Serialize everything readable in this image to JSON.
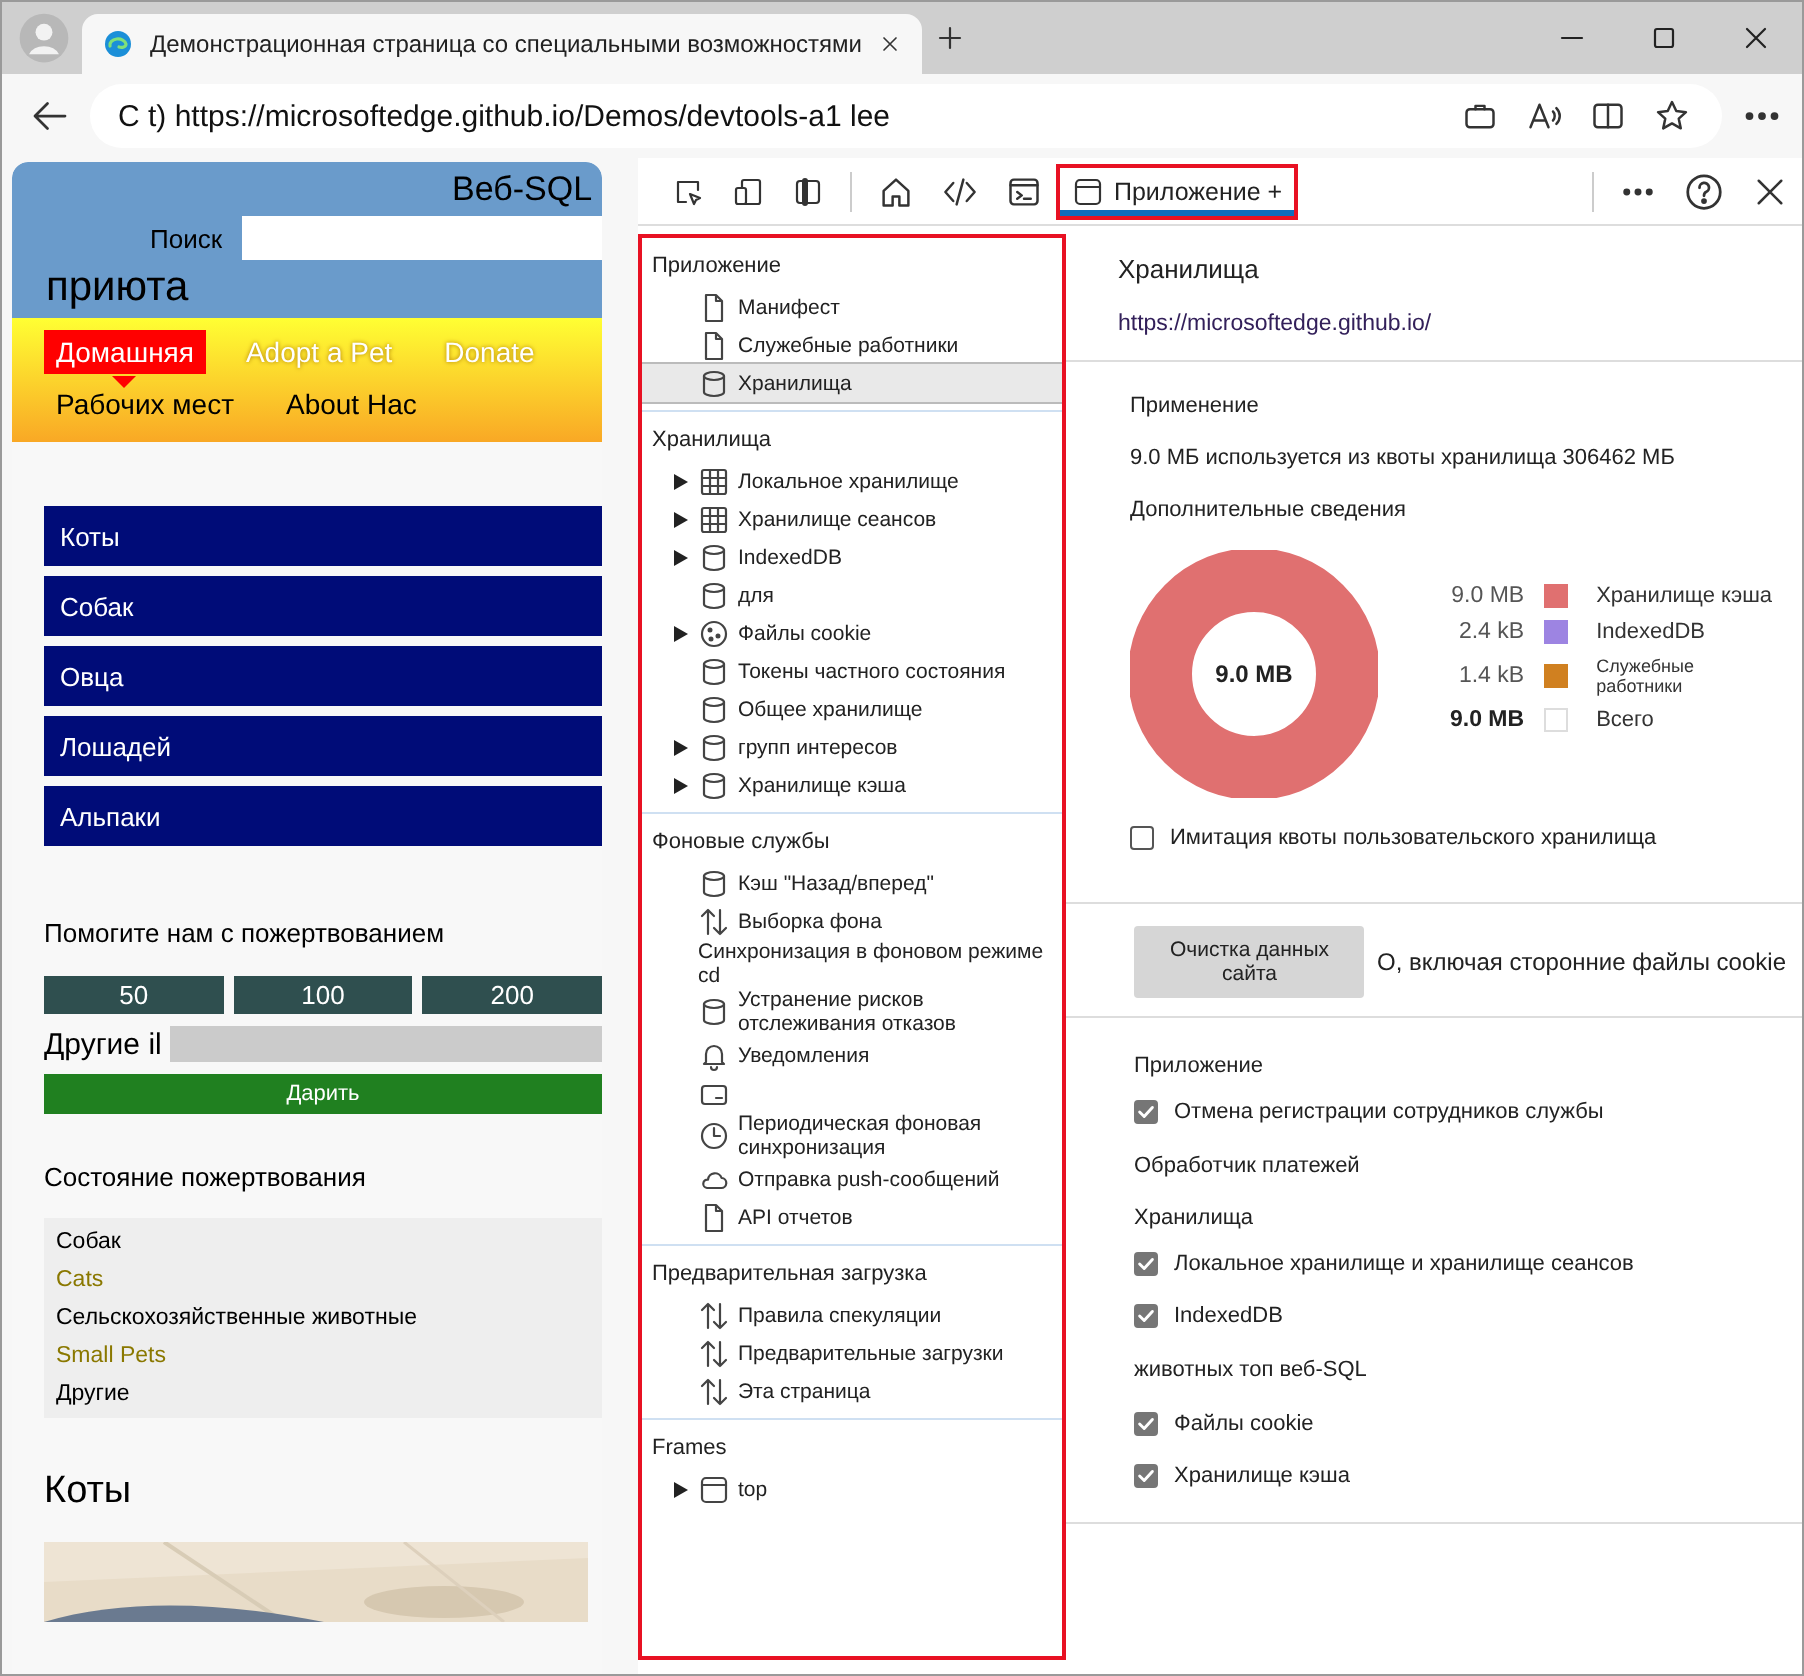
{
  "browser": {
    "tab_title": "Демонстрационная страница со специальными возможностями",
    "url": "C t) https://microsoftedge.github.io/Demos/devtools-a1 lee"
  },
  "page": {
    "header": {
      "overlay_title": "Веб-SQL",
      "search_label": "Поиск",
      "title": "приюта"
    },
    "nav": [
      {
        "label": "Домашняя",
        "selected": true
      },
      {
        "label": "Adopt a Pet",
        "selected": false
      },
      {
        "label": "Donate",
        "selected": false
      },
      {
        "label": "Рабочих мест",
        "selected": false
      },
      {
        "label": "About Нас",
        "selected": false
      }
    ],
    "categories": [
      "Коты",
      "Собак",
      "Овца",
      "Лошадей",
      "Альпаки"
    ],
    "donate": {
      "heading": "Помогите нам с пожертвованием",
      "amounts": [
        "50",
        "100",
        "200"
      ],
      "other_label": "Другие il",
      "button": "Дарить"
    },
    "status": {
      "heading": "Состояние пожертвования",
      "items": [
        {
          "label": "Собак",
          "kind": "label"
        },
        {
          "label": "Cats",
          "kind": "highlight"
        },
        {
          "label": "Сельскохозяйственные животные",
          "kind": "label"
        },
        {
          "label": "Small Pets",
          "kind": "highlight"
        },
        {
          "label": "Другие",
          "kind": "label"
        }
      ]
    },
    "section_title": "Коты"
  },
  "devtools": {
    "tab": {
      "label": "Приложение +",
      "selected": true,
      "highlighted": true
    },
    "sidebar": {
      "highlighted": true,
      "sections": [
        {
          "title": "Приложение",
          "items": [
            {
              "label": "Манифест",
              "kind": "document",
              "expandable": false,
              "selected": false
            },
            {
              "label": "Служебные работники",
              "kind": "document",
              "expandable": false,
              "selected": false
            },
            {
              "label": "Хранилища",
              "kind": "storage",
              "expandable": false,
              "selected": true
            }
          ]
        },
        {
          "title": "Хранилища",
          "items": [
            {
              "label": "Локальное хранилище",
              "kind": "table",
              "expandable": true,
              "selected": false
            },
            {
              "label": "Хранилище сеансов",
              "kind": "table",
              "expandable": true,
              "selected": false
            },
            {
              "label": "IndexedDB",
              "kind": "storage",
              "expandable": true,
              "selected": false
            },
            {
              "label": "для",
              "kind": "storage",
              "expandable": false,
              "selected": false
            },
            {
              "label": "Файлы cookie",
              "kind": "cookie",
              "expandable": true,
              "selected": false
            },
            {
              "label": "Токены частного состояния",
              "kind": "storage",
              "expandable": false,
              "selected": false
            },
            {
              "label": "Общее хранилище",
              "kind": "storage",
              "expandable": false,
              "selected": false
            },
            {
              "label": "групп интересов",
              "kind": "storage",
              "expandable": true,
              "selected": false
            },
            {
              "label": "Хранилище кэша",
              "kind": "storage",
              "expandable": true,
              "selected": false
            }
          ]
        },
        {
          "title": "Фоновые службы",
          "items": [
            {
              "label": "Кэш \"Назад/вперед\"",
              "kind": "storage",
              "expandable": false,
              "selected": false
            },
            {
              "label": "Выборка фона",
              "kind": "transfer",
              "expandable": false,
              "selected": false
            },
            {
              "label": "Синхронизация в фоновом режиме cd",
              "kind": "plain",
              "expandable": false,
              "selected": false
            },
            {
              "label": "Устранение рисков отслеживания отказов",
              "kind": "storage",
              "expandable": false,
              "selected": false
            },
            {
              "label": "Уведомления",
              "kind": "notification",
              "expandable": false,
              "selected": false
            },
            {
              "kind": "payment",
              "expandable": false,
              "selected": false
            },
            {
              "label": "Периодическая фоновая синхронизация",
              "kind": "schedule",
              "expandable": false,
              "selected": false
            },
            {
              "label": "Отправка push-сообщений",
              "kind": "push",
              "expandable": false,
              "selected": false
            },
            {
              "label": "API отчетов",
              "kind": "document",
              "expandable": false,
              "selected": false
            }
          ]
        },
        {
          "title": "Предварительная загрузка",
          "items": [
            {
              "label": "Правила спекуляции",
              "kind": "transfer",
              "expandable": false,
              "selected": false
            },
            {
              "label": "Предварительные загрузки",
              "kind": "transfer",
              "expandable": false,
              "selected": false
            },
            {
              "label": "Эта страница",
              "kind": "transfer",
              "expandable": false,
              "selected": false
            }
          ]
        },
        {
          "title": "Frames",
          "items": [
            {
              "label": "top",
              "kind": "frame",
              "expandable": true,
              "selected": false
            }
          ]
        }
      ]
    },
    "main": {
      "title": "Хранилища",
      "origin": "https://microsoftedge.github.io/",
      "usage": {
        "heading": "Применение",
        "quota": "9.0  МБ используется из квоты хранилища 306462 МБ",
        "details_heading": "Дополнительные сведения",
        "donut_center": "9.0 MB",
        "legend": [
          {
            "value": "9.0 MB",
            "label": "Хранилище кэша",
            "kind": "part",
            "color": "#e07070"
          },
          {
            "value": "2.4 kB",
            "label": "IndexedDB",
            "kind": "part",
            "color": "#9d84e2"
          },
          {
            "value": "1.4 kB",
            "label": "Служебные работники",
            "kind": "part",
            "color": "#d08020"
          },
          {
            "value": "9.0 MB",
            "label": "Всего",
            "kind": "total"
          }
        ],
        "custom_quota": {
          "label": "Имитация квоты пользовательского хранилища",
          "checked": false
        }
      },
      "clear": {
        "button": "Очистка данных сайта",
        "note": "О, включая сторонние файлы cookie"
      },
      "options": [
        {
          "kind": "heading",
          "label": "Приложение"
        },
        {
          "kind": "checkbox",
          "label": "Отмена регистрации сотрудников службы",
          "checked": true
        },
        {
          "kind": "text",
          "label": "Обработчик платежей"
        },
        {
          "kind": "heading",
          "label": "Хранилища"
        },
        {
          "kind": "checkbox",
          "label": "Локальное хранилище и хранилище сеансов",
          "checked": true
        },
        {
          "kind": "checkbox",
          "label": "IndexedDB",
          "checked": true
        },
        {
          "kind": "text",
          "label": "животных топ веб-SQL"
        },
        {
          "kind": "checkbox",
          "label": "Файлы cookie",
          "checked": true
        },
        {
          "kind": "checkbox",
          "label": "Хранилище кэша",
          "checked": true
        }
      ]
    }
  }
}
